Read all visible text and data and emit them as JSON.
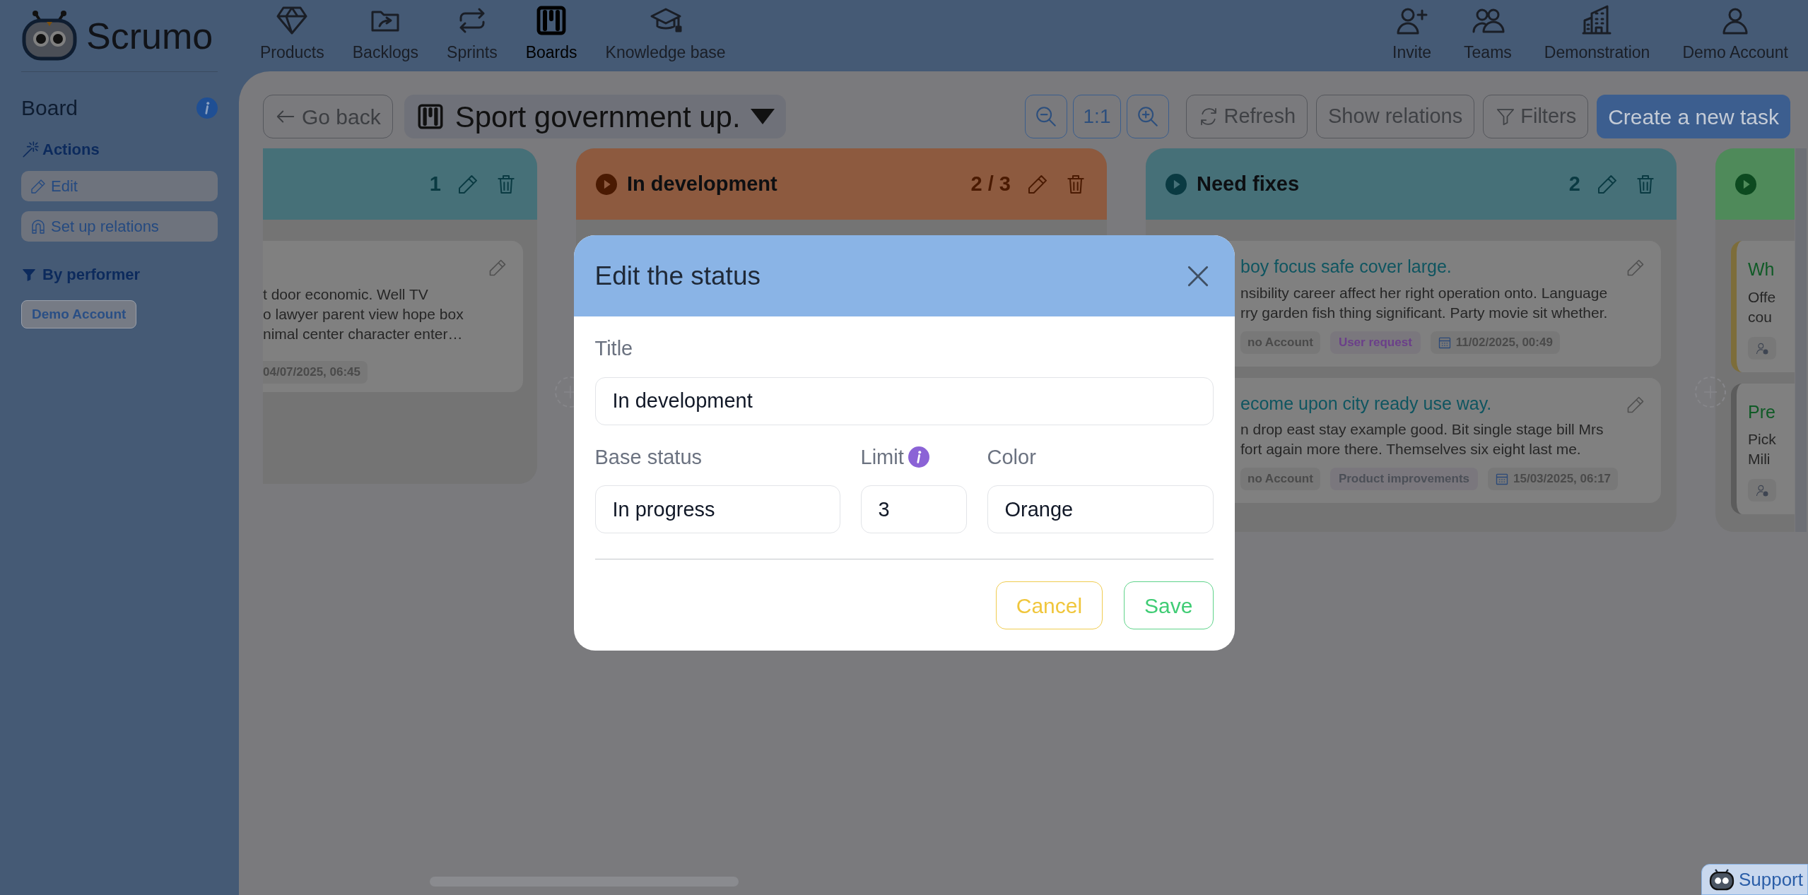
{
  "app": {
    "name": "Scrumo"
  },
  "nav": [
    {
      "label": "Products",
      "selected": false
    },
    {
      "label": "Backlogs",
      "selected": false
    },
    {
      "label": "Sprints",
      "selected": false
    },
    {
      "label": "Boards",
      "selected": true
    },
    {
      "label": "Knowledge base",
      "selected": false
    }
  ],
  "account_nav": [
    {
      "label": "Invite"
    },
    {
      "label": "Teams"
    },
    {
      "label": "Demonstration"
    },
    {
      "label": "Demo Account"
    }
  ],
  "sidebar": {
    "title": "Board",
    "actions_heading": "Actions",
    "actions": [
      {
        "label": "Edit"
      },
      {
        "label": "Set up relations"
      }
    ],
    "filter_heading": "By performer",
    "performers": [
      {
        "label": "Demo Account",
        "selected": false
      }
    ]
  },
  "toolbar": {
    "back": "Go back",
    "board_title": "Sport government up.",
    "buttons": [
      {
        "kind": "zoom_out"
      },
      {
        "kind": "text",
        "label": "1:1"
      },
      {
        "kind": "zoom_in"
      },
      {
        "kind": "refresh",
        "label": "Refresh"
      },
      {
        "kind": "plain",
        "label": "Show relations"
      },
      {
        "kind": "filter",
        "label": "Filters"
      },
      {
        "kind": "primary",
        "label": "Create a new task"
      }
    ]
  },
  "columns": [
    {
      "color": "#467078",
      "count": "1",
      "cards": [
        {
          "description": "t door economic. Well TV\no lawyer parent view hope box\nnimal center character enter…",
          "tags": [
            {
              "kind": "plain",
              "text": "04/07/2025, 06:45"
            }
          ]
        }
      ]
    },
    {
      "title": "In development",
      "color": "#8d5a3f",
      "count": "2 / 3"
    },
    {
      "title": "Need fixes",
      "color": "#467078",
      "count": "2",
      "cards": [
        {
          "title": "boy focus safe cover large.",
          "description": "nsibility career affect her right operation onto. Language\nrry garden fish thing significant. Party movie sit whether.",
          "tags": [
            {
              "kind": "assignee",
              "text": "no Account"
            },
            {
              "kind": "type",
              "text": "User request",
              "color": "#6b3f8a"
            },
            {
              "kind": "date",
              "text": "11/02/2025, 00:49"
            }
          ]
        },
        {
          "title": "ecome upon city ready use way.",
          "description": "n drop east stay example good. Bit single stage bill Mrs\nfort again more there. Themselves six eight last me.",
          "tags": [
            {
              "kind": "assignee",
              "text": "no Account"
            },
            {
              "kind": "type",
              "text": "Product improvements",
              "color": "#4b4f57"
            },
            {
              "kind": "date",
              "text": "15/03/2025, 06:17"
            }
          ]
        }
      ]
    },
    {
      "color": "#4f8a5a",
      "cards": [
        {
          "color": "#7d6d3a",
          "title": "Wh",
          "description": "Offe\ncou",
          "tags": [
            {
              "kind": "assignee"
            }
          ]
        },
        {
          "color": "#5c5c5c",
          "title": "Pre",
          "description": "Pick\nMili",
          "tags": [
            {
              "kind": "assignee"
            }
          ]
        }
      ]
    }
  ],
  "modal": {
    "title": "Edit the status",
    "fields": [
      {
        "label": "Title",
        "value": "In development",
        "info": false
      },
      {
        "label": "Base status",
        "value": "In progress",
        "info": false
      },
      {
        "label": "Limit",
        "value": "3",
        "info": true
      },
      {
        "label": "Color",
        "value": "Orange",
        "info": false
      }
    ],
    "buttons": [
      {
        "kind": "cancel",
        "label": "Cancel"
      },
      {
        "kind": "save",
        "label": "Save"
      }
    ]
  },
  "support": {
    "label": "Support"
  }
}
